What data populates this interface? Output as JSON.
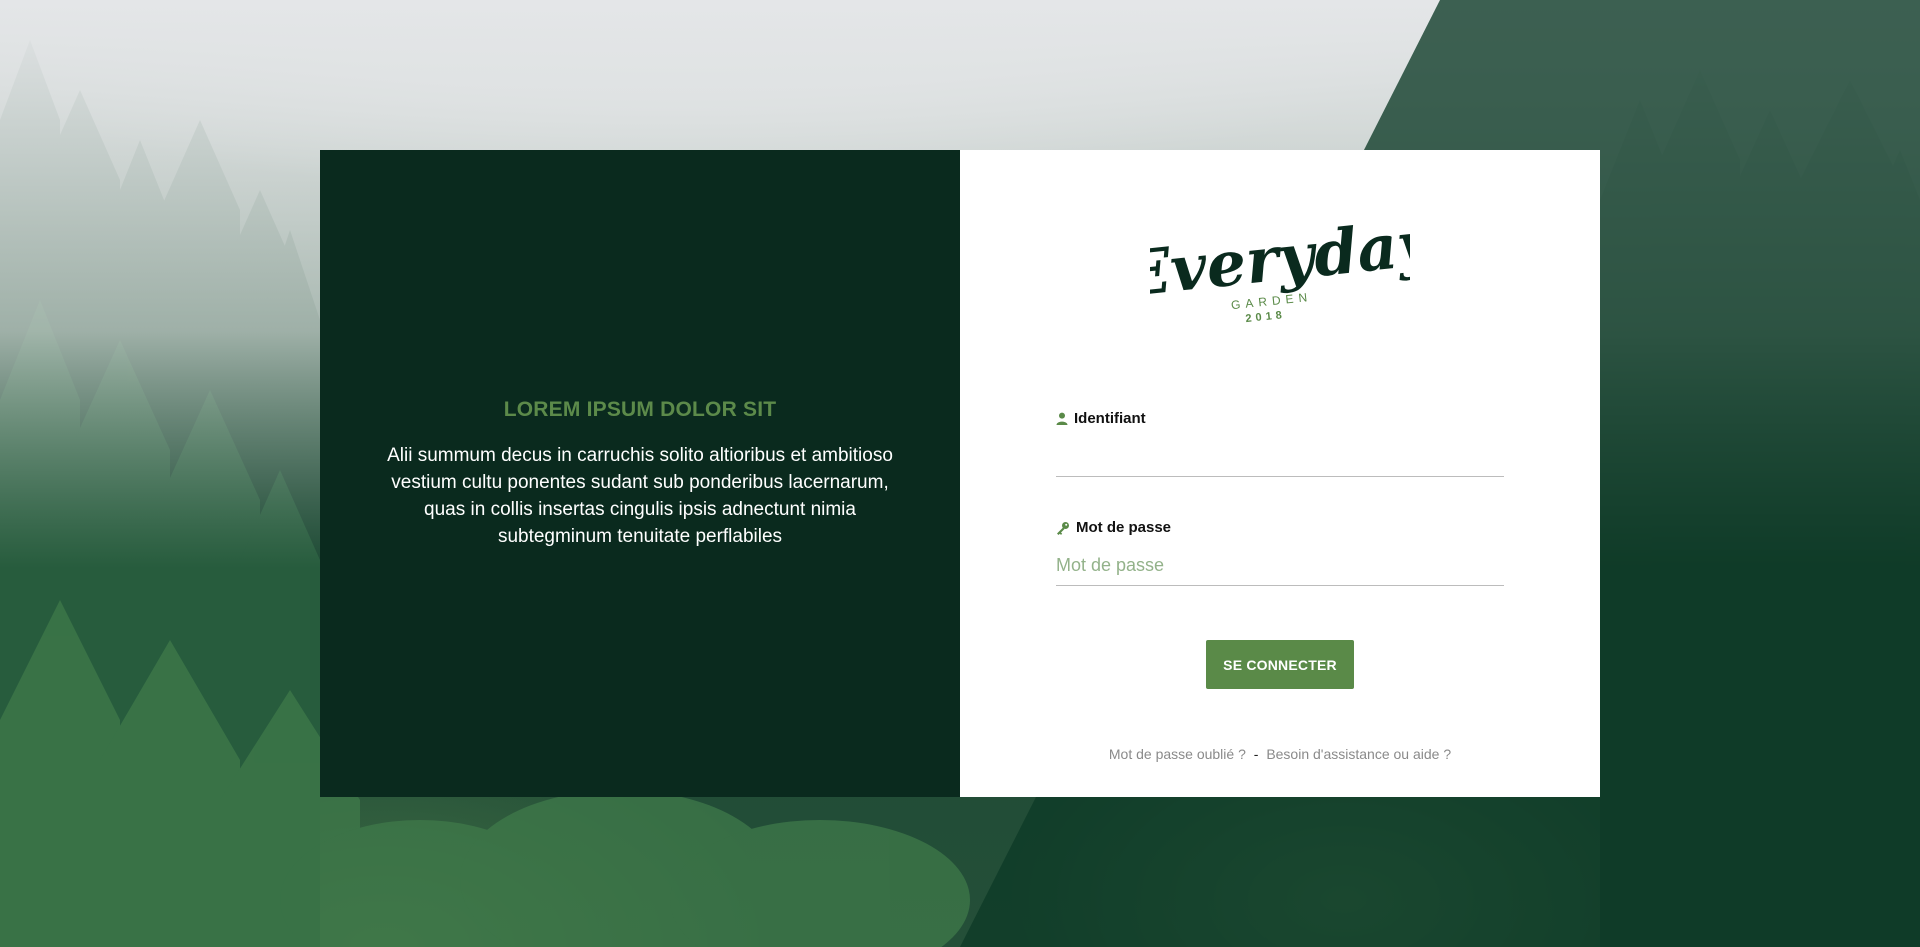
{
  "left_panel": {
    "title": "LOREM IPSUM DOLOR SIT",
    "text": "Alii summum decus in carruchis solito altioribus et ambitioso vestium cultu ponentes sudant sub ponderibus lacernarum, quas in collis insertas cingulis ipsis adnectunt nimia subtegminum tenuitate perflabiles"
  },
  "logo": {
    "brand": "Everyday",
    "sub": "GARDEN",
    "year": "2018"
  },
  "form": {
    "username": {
      "label": "Identifiant",
      "value": "",
      "placeholder": "",
      "icon": "user-icon"
    },
    "password": {
      "label": "Mot de passe",
      "value": "",
      "placeholder": "Mot de passe",
      "icon": "key-icon"
    },
    "submit_label": "SE CONNECTER"
  },
  "footer": {
    "forgot_label": "Mot de passe oublié ?",
    "separator": "-",
    "help_label": "Besoin d'assistance ou aide ?"
  },
  "colors": {
    "dark_green": "#0a2a1e",
    "accent_green": "#5a8a48",
    "white": "#ffffff"
  }
}
